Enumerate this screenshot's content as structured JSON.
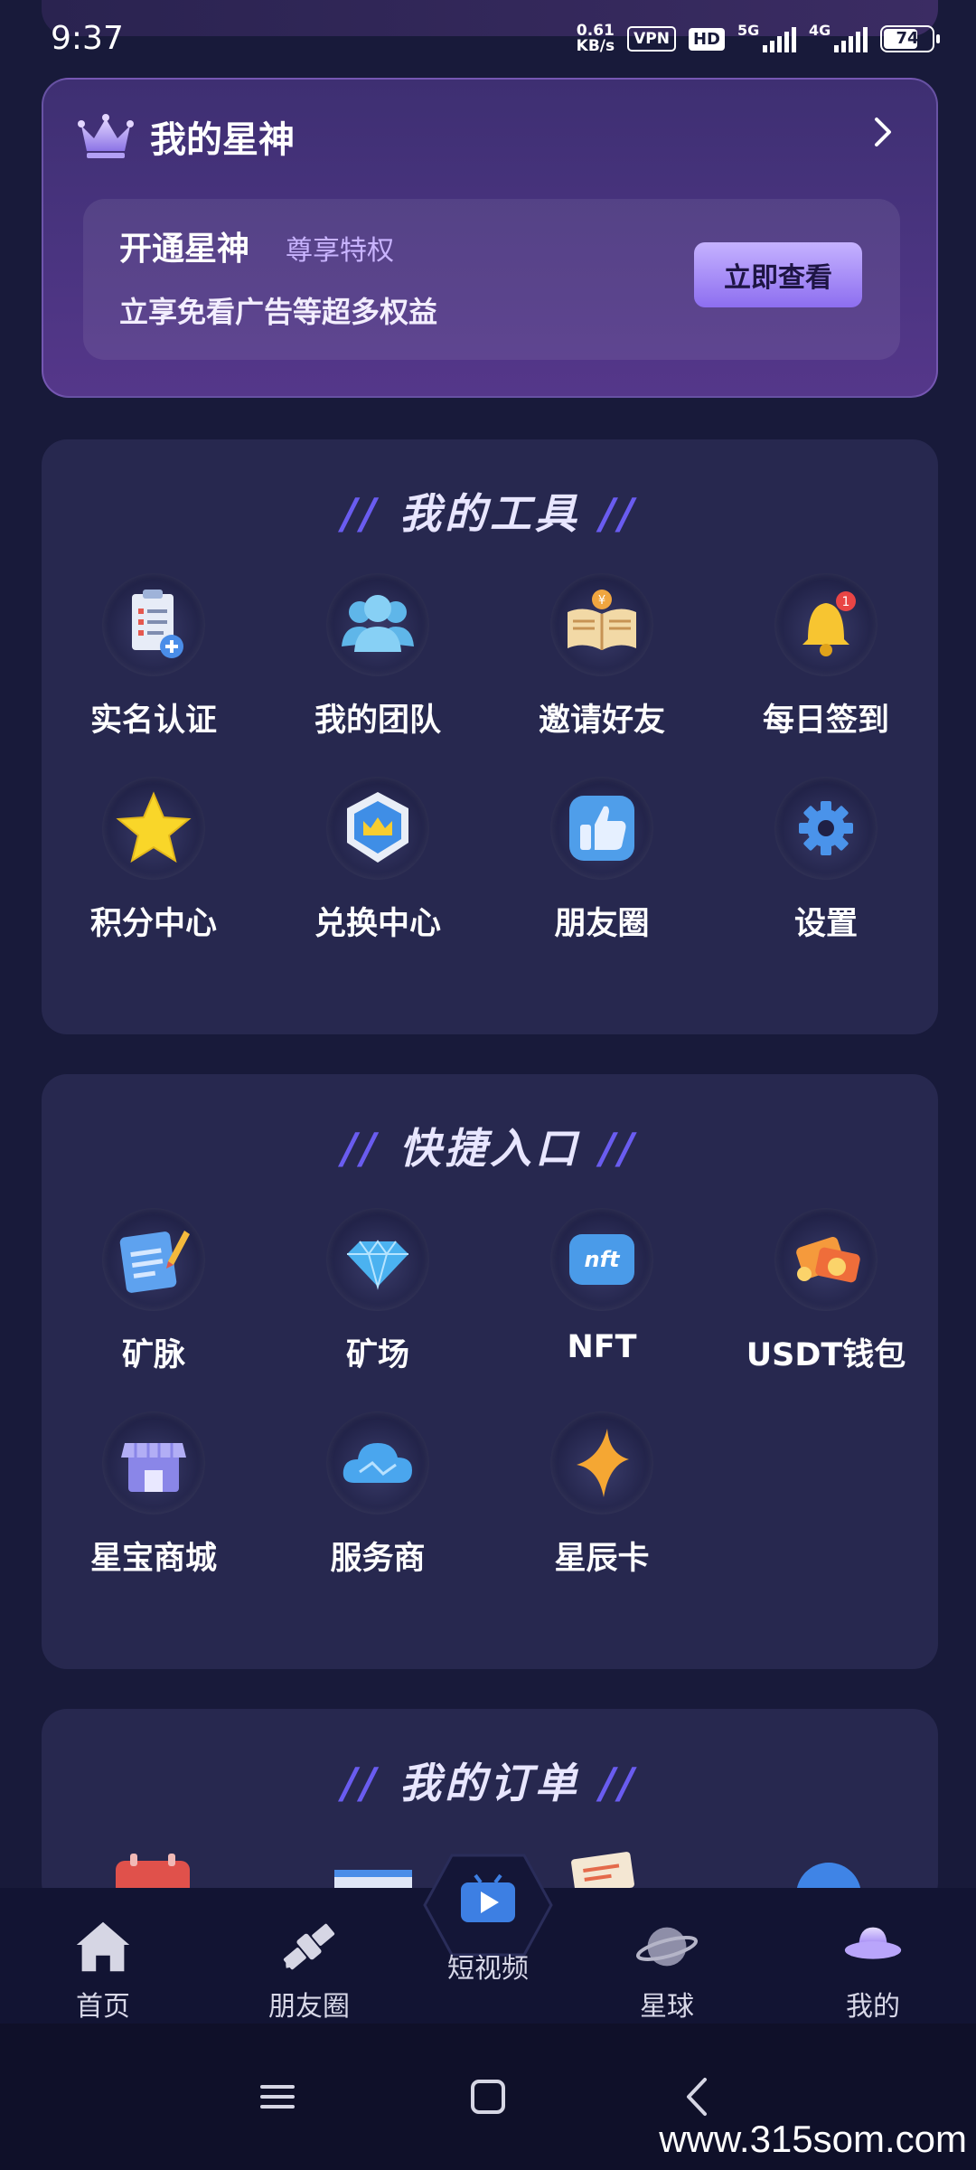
{
  "status_bar": {
    "time": "9:37",
    "speed_value": "0.61",
    "speed_unit": "KB/s",
    "vpn": "VPN",
    "hd": "HD",
    "network_1": "5G",
    "network_2": "4G",
    "battery": "74",
    "battery_level": 0.74
  },
  "vip": {
    "title": "我的星神",
    "heading": "开通星神",
    "subheading": "尊享特权",
    "description": "立享免看广告等超多权益",
    "button_label": "立即查看"
  },
  "tools": {
    "title": "我的工具",
    "items": [
      {
        "label": "实名认证",
        "icon": "id-verify-icon"
      },
      {
        "label": "我的团队",
        "icon": "team-icon"
      },
      {
        "label": "邀请好友",
        "icon": "invite-book-icon"
      },
      {
        "label": "每日签到",
        "icon": "bell-icon"
      },
      {
        "label": "积分中心",
        "icon": "star-icon"
      },
      {
        "label": "兑换中心",
        "icon": "crown-shield-icon"
      },
      {
        "label": "朋友圈",
        "icon": "thumbs-up-icon"
      },
      {
        "label": "设置",
        "icon": "gear-icon"
      }
    ]
  },
  "shortcuts": {
    "title": "快捷入口",
    "items": [
      {
        "label": "矿脉",
        "icon": "notepad-icon"
      },
      {
        "label": "矿场",
        "icon": "diamond-icon"
      },
      {
        "label": "NFT",
        "icon": "nft-icon",
        "icon_text": "nft"
      },
      {
        "label": "USDT钱包",
        "icon": "wallet-icon"
      },
      {
        "label": "星宝商城",
        "icon": "shop-icon"
      },
      {
        "label": "服务商",
        "icon": "cloud-icon"
      },
      {
        "label": "星辰卡",
        "icon": "sparkle-icon"
      }
    ]
  },
  "orders": {
    "title": "我的订单"
  },
  "bottom_nav": {
    "items": [
      {
        "label": "首页",
        "icon": "home-icon"
      },
      {
        "label": "朋友圈",
        "icon": "satellite-icon"
      },
      {
        "label": "短视频",
        "icon": "video-play-icon"
      },
      {
        "label": "星球",
        "icon": "planet-icon"
      },
      {
        "label": "我的",
        "icon": "ufo-icon"
      }
    ]
  },
  "watermark": "www.315som.com",
  "colors": {
    "background": "#181a3a",
    "panel": "#27284f",
    "accent": "#8d6ef0",
    "nav": "#121433"
  }
}
